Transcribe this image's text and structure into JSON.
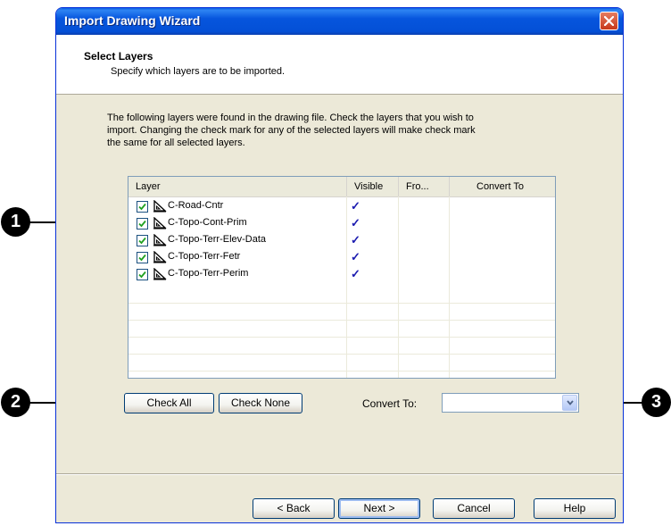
{
  "window": {
    "title": "Import Drawing Wizard"
  },
  "header": {
    "title": "Select Layers",
    "subtitle": "Specify which layers are to be imported."
  },
  "intro": {
    "line1": "The following layers were found in the drawing file. Check the layers that you wish to",
    "line2": "import. Changing the check mark for any of the selected layers will make check mark",
    "line3": "the same for all selected layers."
  },
  "list": {
    "columns": [
      "Layer",
      "Visible",
      "Fro...",
      "Convert To"
    ],
    "rows": [
      {
        "name": "C-Road-Cntr",
        "checked": true,
        "visible": "✓"
      },
      {
        "name": "C-Topo-Cont-Prim",
        "checked": true,
        "visible": "✓"
      },
      {
        "name": "C-Topo-Terr-Elev-Data",
        "checked": true,
        "visible": "✓"
      },
      {
        "name": "C-Topo-Terr-Fetr",
        "checked": true,
        "visible": "✓"
      },
      {
        "name": "C-Topo-Terr-Perim",
        "checked": true,
        "visible": "✓"
      }
    ],
    "row_icon": "triangle-layer-icon"
  },
  "buttons": {
    "check_all": "Check All",
    "check_none": "Check None",
    "back": "< Back",
    "next": "Next >",
    "cancel": "Cancel",
    "help": "Help"
  },
  "convert_to": {
    "label": "Convert To:",
    "value": ""
  },
  "callouts": [
    "1",
    "2",
    "3"
  ],
  "colors": {
    "titlebar": "#0450d6",
    "accent_check": "#1c1cb0",
    "callout": "#000000"
  }
}
